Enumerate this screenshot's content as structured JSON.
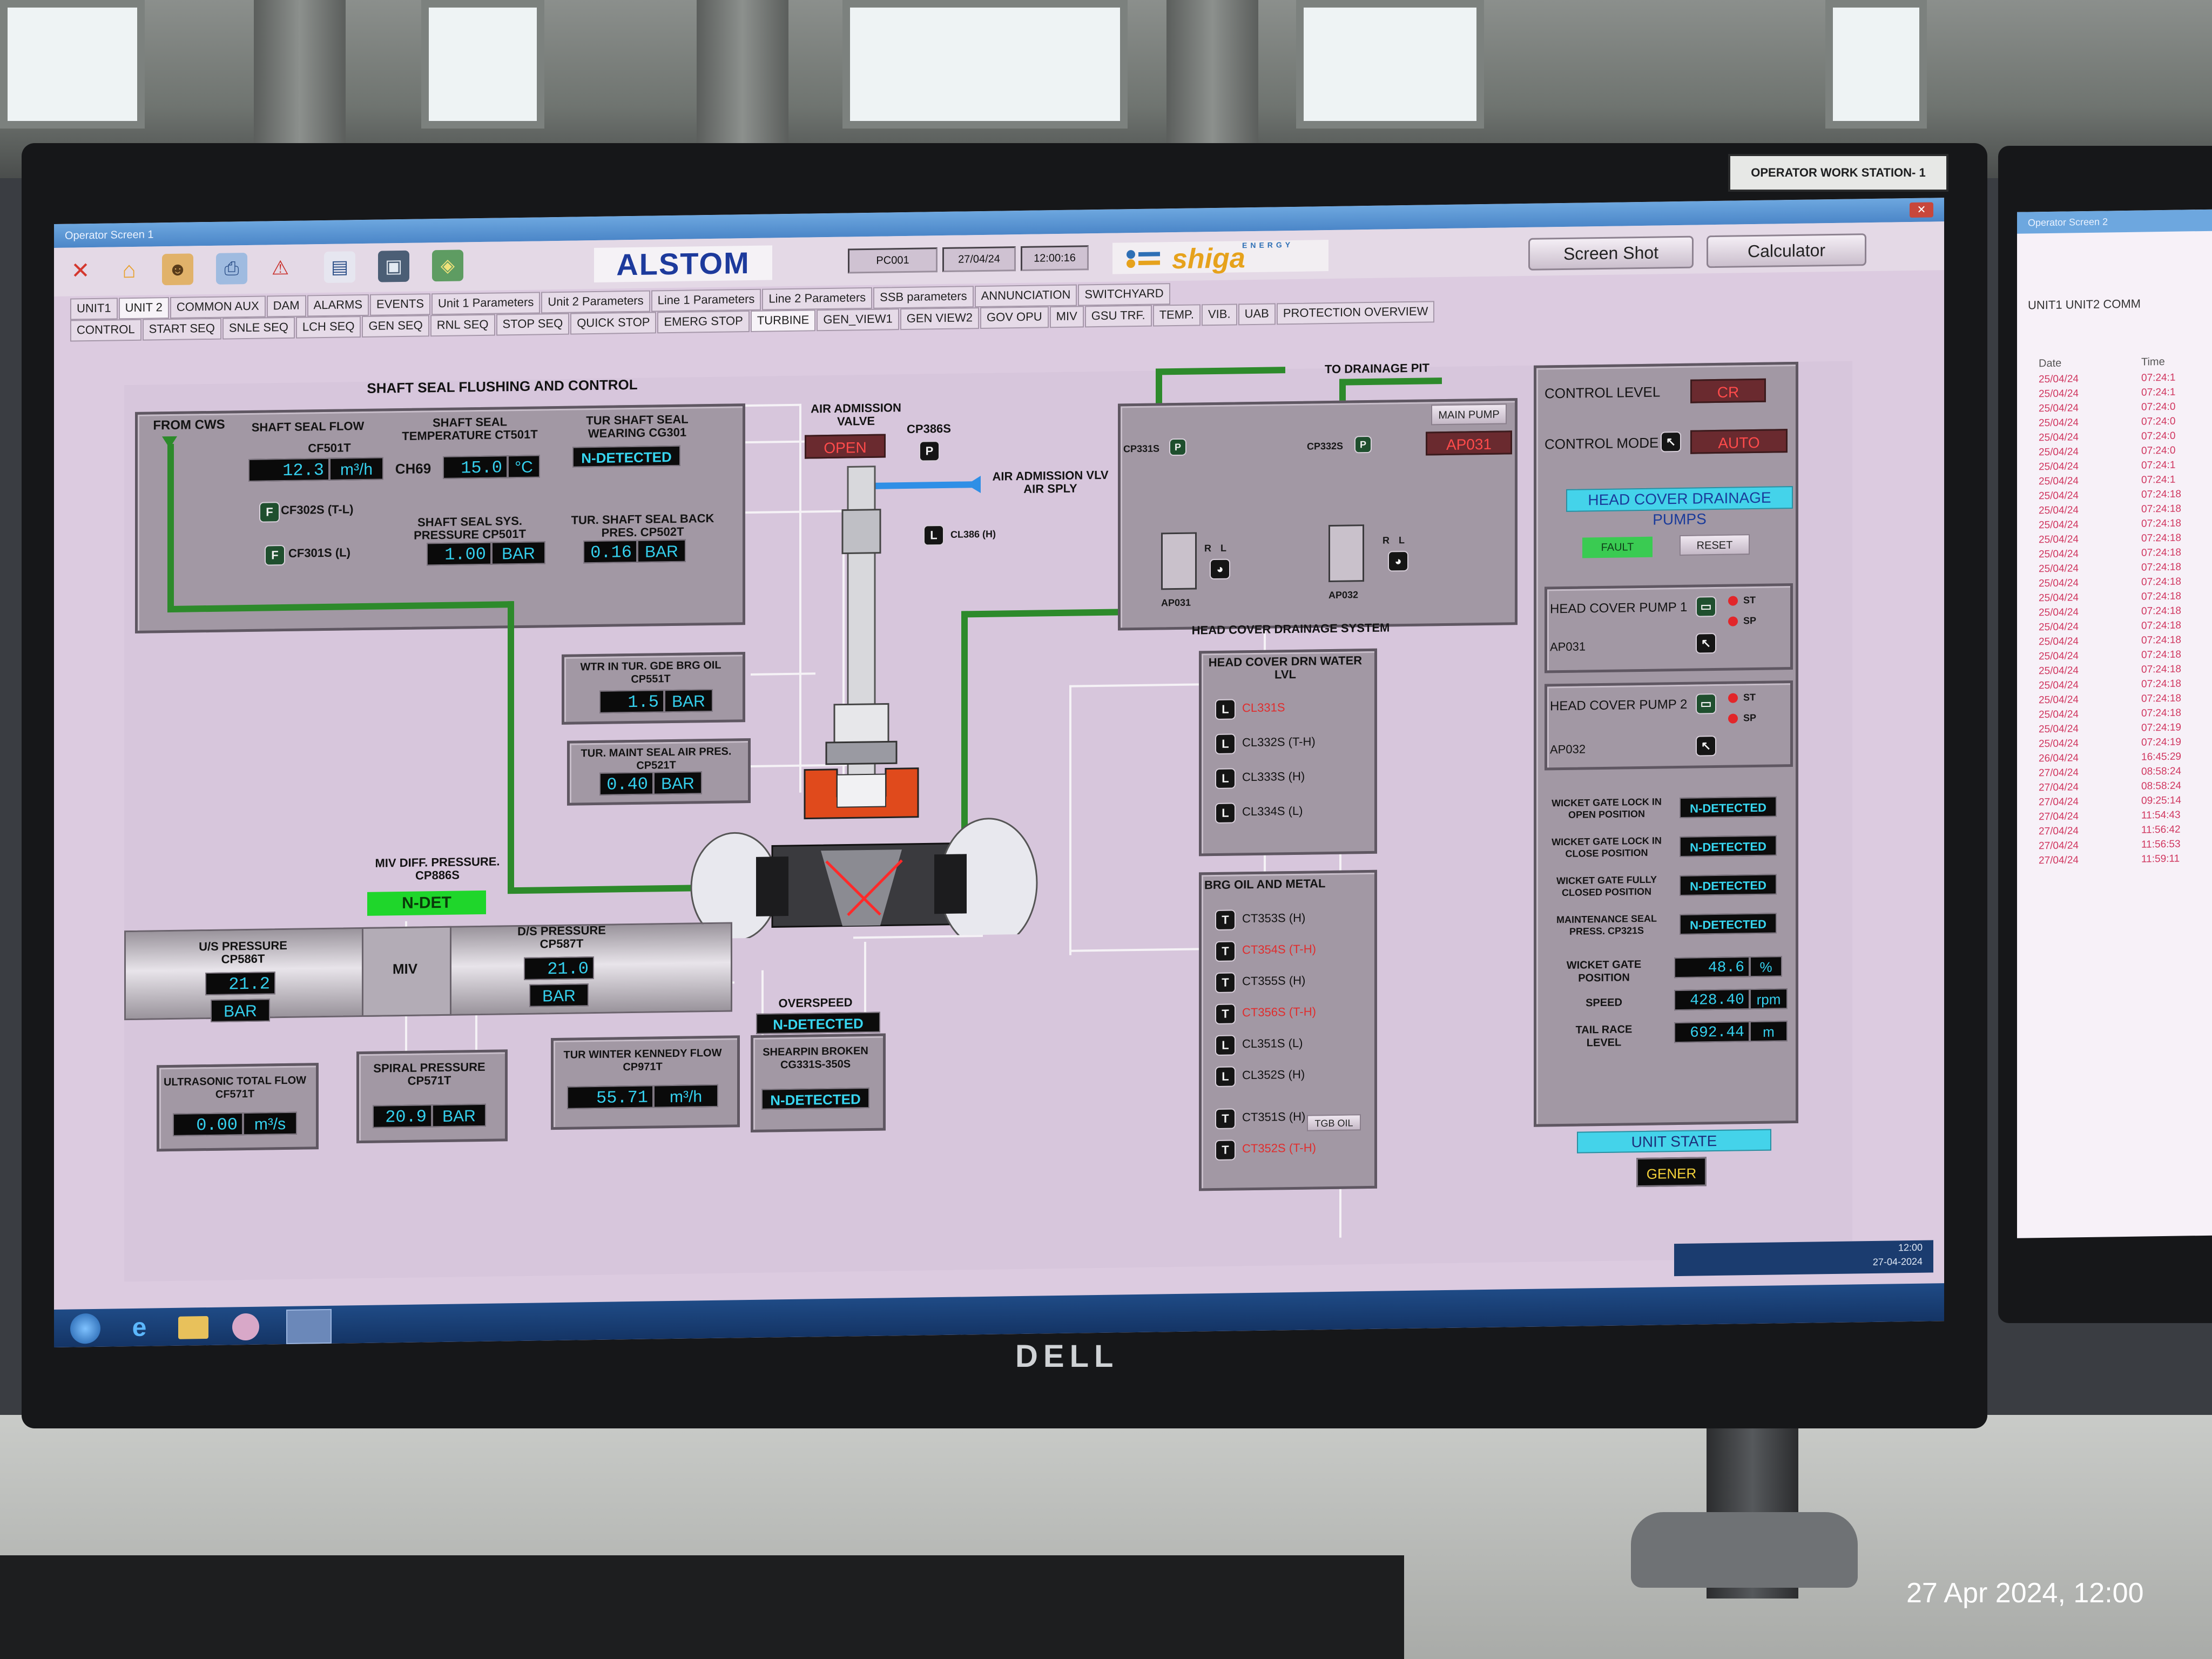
{
  "environment": {
    "workstation_label": "OPERATOR WORK STATION- 1",
    "monitor_brand": "DELL",
    "photo_timestamp": "27 Apr 2024, 12:00"
  },
  "window": {
    "title": "Operator Screen 1"
  },
  "header": {
    "brand": "ALSTOM",
    "station": "PC001",
    "date": "27/04/24",
    "time": "12:00:16",
    "partner_logo": "shiga",
    "partner_logo_sub": "ENERGY",
    "screen_shot_label": "Screen Shot",
    "calculator_label": "Calculator"
  },
  "nav": {
    "row1": [
      "UNIT1",
      "UNIT 2",
      "COMMON AUX",
      "DAM",
      "ALARMS",
      "EVENTS",
      "Unit 1 Parameters",
      "Unit 2 Parameters",
      "Line 1 Parameters",
      "Line 2 Parameters",
      "SSB parameters",
      "ANNUNCIATION",
      "SWITCHYARD"
    ],
    "row2": [
      "CONTROL",
      "START SEQ",
      "SNLE SEQ",
      "LCH SEQ",
      "GEN SEQ",
      "RNL SEQ",
      "STOP SEQ",
      "QUICK STOP",
      "EMERG STOP",
      "TURBINE",
      "GEN_VIEW1",
      "GEN VIEW2",
      "GOV OPU",
      "MIV",
      "GSU TRF.",
      "TEMP.",
      "VIB.",
      "UAB",
      "PROTECTION OVERVIEW"
    ]
  },
  "shaft_seal": {
    "section_title": "SHAFT SEAL FLUSHING AND CONTROL",
    "from_cws": "FROM CWS",
    "flow_label": "SHAFT SEAL FLOW",
    "flow_tag": "CF501T",
    "flow_value": "12.3",
    "flow_unit": "m³/h",
    "temp_label": "SHAFT SEAL TEMPERATURE CT501T",
    "temp_tag": "CH69",
    "temp_value": "15.0",
    "temp_unit": "°C",
    "wearing_label": "TUR SHAFT SEAL WEARING CG301",
    "wearing_value": "N-DETECTED",
    "cf302s": "CF302S (T-L)",
    "cf301s": "CF301S (L)",
    "sys_pressure_label": "SHAFT SEAL SYS. PRESSURE CP501T",
    "sys_pressure_value": "1.00",
    "sys_pressure_unit": "BAR",
    "back_pressure_label": "TUR. SHAFT SEAL BACK PRES. CP502T",
    "back_pressure_value": "0.16",
    "back_pressure_unit": "BAR"
  },
  "air_admission": {
    "valve_label": "AIR ADMISSION VALVE",
    "valve_state": "OPEN",
    "pressure_tag": "CP386S",
    "supply_label": "AIR ADMISSION VLV AIR SPLY",
    "level_tag": "CL386 (H)"
  },
  "guide_bearing": {
    "wtr_label": "WTR IN TUR. GDE BRG OIL CP551T",
    "wtr_value": "1.5",
    "wtr_unit": "BAR",
    "maint_label": "TUR. MAINT SEAL AIR PRES. CP521T",
    "maint_value": "0.40",
    "maint_unit": "BAR"
  },
  "miv": {
    "diff_label": "MIV DIFF. PRESSURE. CP886S",
    "diff_state": "N-DET",
    "us_label": "U/S PRESSURE CP586T",
    "us_value": "21.2",
    "us_unit": "BAR",
    "valve_label": "MIV",
    "ds_label": "D/S PRESSURE CP587T",
    "ds_value": "21.0",
    "ds_unit": "BAR"
  },
  "flows": {
    "ultrasonic_label": "ULTRASONIC TOTAL FLOW CF571T",
    "ultrasonic_value": "0.00",
    "ultrasonic_unit": "m³/s",
    "spiral_label": "SPIRAL PRESSURE CP571T",
    "spiral_value": "20.9",
    "spiral_unit": "BAR",
    "kennedy_label": "TUR WINTER KENNEDY FLOW CP971T",
    "kennedy_value": "55.71",
    "kennedy_unit": "m³/h"
  },
  "turbine_status": {
    "overspeed_label": "OVERSPEED",
    "overspeed_value": "N-DETECTED",
    "shearpin_label": "SHEARPIN BROKEN CG331S-350S",
    "shearpin_value": "N-DETECTED"
  },
  "drainage": {
    "pit_label": "TO DRAINAGE PIT",
    "main_pump": "MAIN PUMP",
    "cp331s": "CP331S",
    "cp332s": "CP332S",
    "pump_state": "AP031",
    "ap031": "AP031",
    "ap032": "AP032",
    "r": "R",
    "l": "L",
    "system_label": "HEAD COVER DRAINAGE SYSTEM",
    "water_title": "HEAD COVER DRN WATER LVL",
    "water_levels": [
      {
        "chip": "L",
        "text": "CL331S",
        "alarm": true
      },
      {
        "chip": "L",
        "text": "CL332S (T-H)",
        "alarm": false
      },
      {
        "chip": "L",
        "text": "CL333S (H)",
        "alarm": false
      },
      {
        "chip": "L",
        "text": "CL334S (L)",
        "alarm": false
      }
    ]
  },
  "bearing_oil": {
    "title": "BRG OIL AND METAL",
    "rows": [
      {
        "chip": "T",
        "text": "CT353S (H)",
        "alarm": false
      },
      {
        "chip": "T",
        "text": "CT354S (T-H)",
        "alarm": true
      },
      {
        "chip": "T",
        "text": "CT355S (H)",
        "alarm": false
      },
      {
        "chip": "T",
        "text": "CT356S (T-H)",
        "alarm": true
      },
      {
        "chip": "L",
        "text": "CL351S (L)",
        "alarm": false
      },
      {
        "chip": "L",
        "text": "CL352S (H)",
        "alarm": false
      },
      {
        "chip": "T",
        "text": "CT351S (H)",
        "alarm": false
      },
      {
        "chip": "T",
        "text": "CT352S (T-H)",
        "alarm": true
      }
    ],
    "tgb_oil": "TGB OIL"
  },
  "control": {
    "level_label": "CONTROL LEVEL",
    "level_value": "CR",
    "mode_label": "CONTROL MODE",
    "mode_value": "AUTO",
    "pumps_title": "HEAD COVER DRAINAGE PUMPS",
    "fault": "FAULT",
    "reset": "RESET",
    "pump1_label": "HEAD COVER PUMP 1",
    "pump1_tag": "AP031",
    "pump2_label": "HEAD COVER PUMP 2",
    "pump2_tag": "AP032",
    "st": "ST",
    "sp": "SP",
    "status_rows": [
      {
        "label": "WICKET GATE LOCK IN OPEN POSITION",
        "value": "N-DETECTED"
      },
      {
        "label": "WICKET GATE LOCK IN CLOSE POSITION",
        "value": "N-DETECTED"
      },
      {
        "label": "WICKET GATE FULLY CLOSED POSITION",
        "value": "N-DETECTED"
      },
      {
        "label": "MAINTENANCE SEAL PRESS. CP321S",
        "value": "N-DETECTED"
      }
    ],
    "wicket_label": "WICKET GATE POSITION",
    "wicket_value": "48.6",
    "wicket_unit": "%",
    "speed_label": "SPEED",
    "speed_value": "428.40",
    "speed_unit": "rpm",
    "tail_label": "TAIL RACE LEVEL",
    "tail_value": "692.44",
    "tail_unit": "m",
    "unit_state_label": "UNIT STATE",
    "unit_state_value": "GENER"
  },
  "tray": {
    "time": "12:00",
    "date": "27-04-2024"
  },
  "side_screen": {
    "title": "Operator Screen 2",
    "tabs": "UNIT1  UNIT2  COMM",
    "col_date": "Date",
    "col_time": "Time",
    "log": [
      [
        "25/04/24",
        "07:24:1"
      ],
      [
        "25/04/24",
        "07:24:1"
      ],
      [
        "25/04/24",
        "07:24:0"
      ],
      [
        "25/04/24",
        "07:24:0"
      ],
      [
        "25/04/24",
        "07:24:0"
      ],
      [
        "25/04/24",
        "07:24:0"
      ],
      [
        "25/04/24",
        "07:24:1"
      ],
      [
        "25/04/24",
        "07:24:1"
      ],
      [
        "25/04/24",
        "07:24:18"
      ],
      [
        "25/04/24",
        "07:24:18"
      ],
      [
        "25/04/24",
        "07:24:18"
      ],
      [
        "25/04/24",
        "07:24:18"
      ],
      [
        "25/04/24",
        "07:24:18"
      ],
      [
        "25/04/24",
        "07:24:18"
      ],
      [
        "25/04/24",
        "07:24:18"
      ],
      [
        "25/04/24",
        "07:24:18"
      ],
      [
        "25/04/24",
        "07:24:18"
      ],
      [
        "25/04/24",
        "07:24:18"
      ],
      [
        "25/04/24",
        "07:24:18"
      ],
      [
        "25/04/24",
        "07:24:18"
      ],
      [
        "25/04/24",
        "07:24:18"
      ],
      [
        "25/04/24",
        "07:24:18"
      ],
      [
        "25/04/24",
        "07:24:18"
      ],
      [
        "25/04/24",
        "07:24:18"
      ],
      [
        "25/04/24",
        "07:24:19"
      ],
      [
        "25/04/24",
        "07:24:19"
      ],
      [
        "26/04/24",
        "16:45:29"
      ],
      [
        "27/04/24",
        "08:58:24"
      ],
      [
        "27/04/24",
        "08:58:24"
      ],
      [
        "27/04/24",
        "09:25:14"
      ],
      [
        "27/04/24",
        "11:54:43"
      ],
      [
        "27/04/24",
        "11:56:42"
      ],
      [
        "27/04/24",
        "11:56:53"
      ],
      [
        "27/04/24",
        "11:59:11"
      ]
    ]
  }
}
